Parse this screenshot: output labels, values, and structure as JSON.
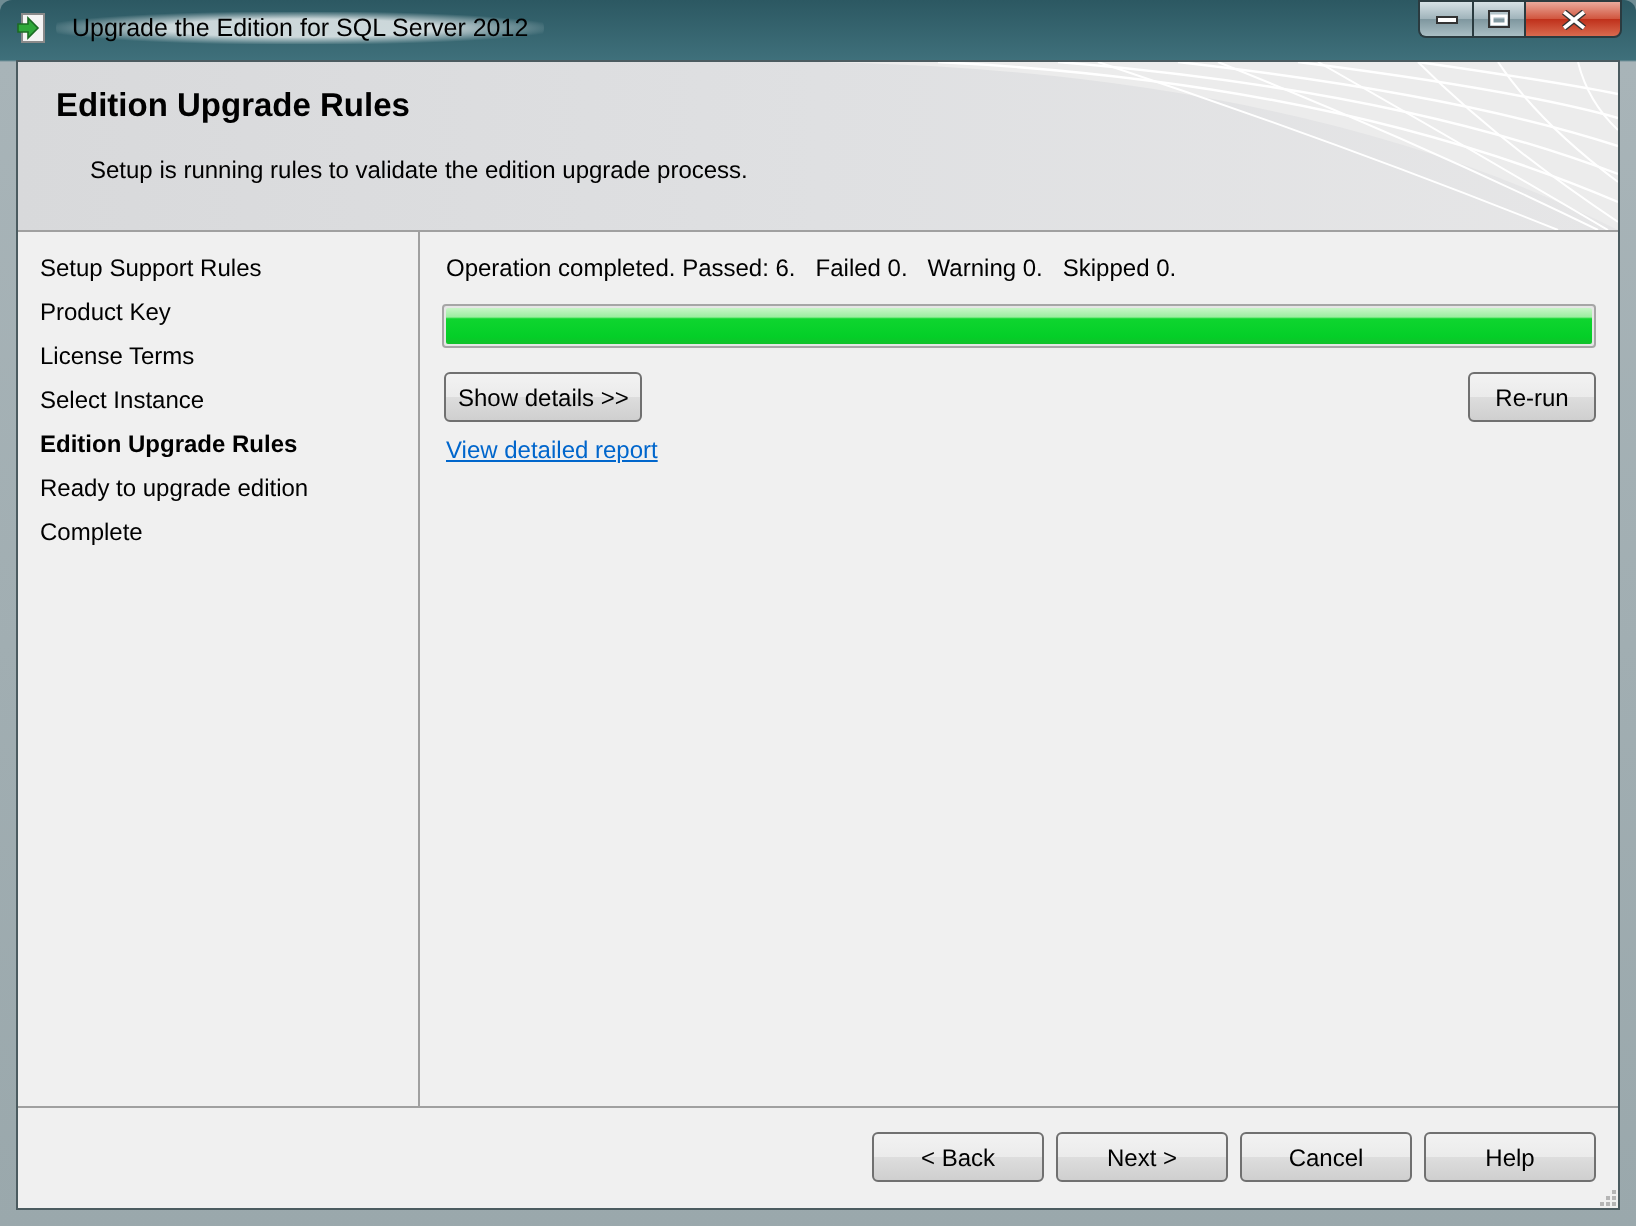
{
  "window": {
    "title": "Upgrade the Edition for SQL Server 2012"
  },
  "header": {
    "title": "Edition Upgrade Rules",
    "description": "Setup is running rules to validate the edition upgrade process."
  },
  "steps": [
    {
      "label": "Setup Support Rules",
      "selected": false
    },
    {
      "label": "Product Key",
      "selected": false
    },
    {
      "label": "License Terms",
      "selected": false
    },
    {
      "label": "Select Instance",
      "selected": false
    },
    {
      "label": "Edition Upgrade Rules",
      "selected": true
    },
    {
      "label": "Ready to upgrade edition",
      "selected": false
    },
    {
      "label": "Complete",
      "selected": false
    }
  ],
  "rules": {
    "status": "Operation completed. Passed: 6.   Failed 0.   Warning 0.   Skipped 0.",
    "progress": {
      "level": 1
    },
    "show_details_button": "Show details >>",
    "rerun_button": "Re-run",
    "report_link": "View detailed report"
  },
  "buttons": [
    {
      "label": "< Back"
    },
    {
      "label": "Next >"
    },
    {
      "label": "Cancel"
    },
    {
      "label": "Help"
    }
  ]
}
